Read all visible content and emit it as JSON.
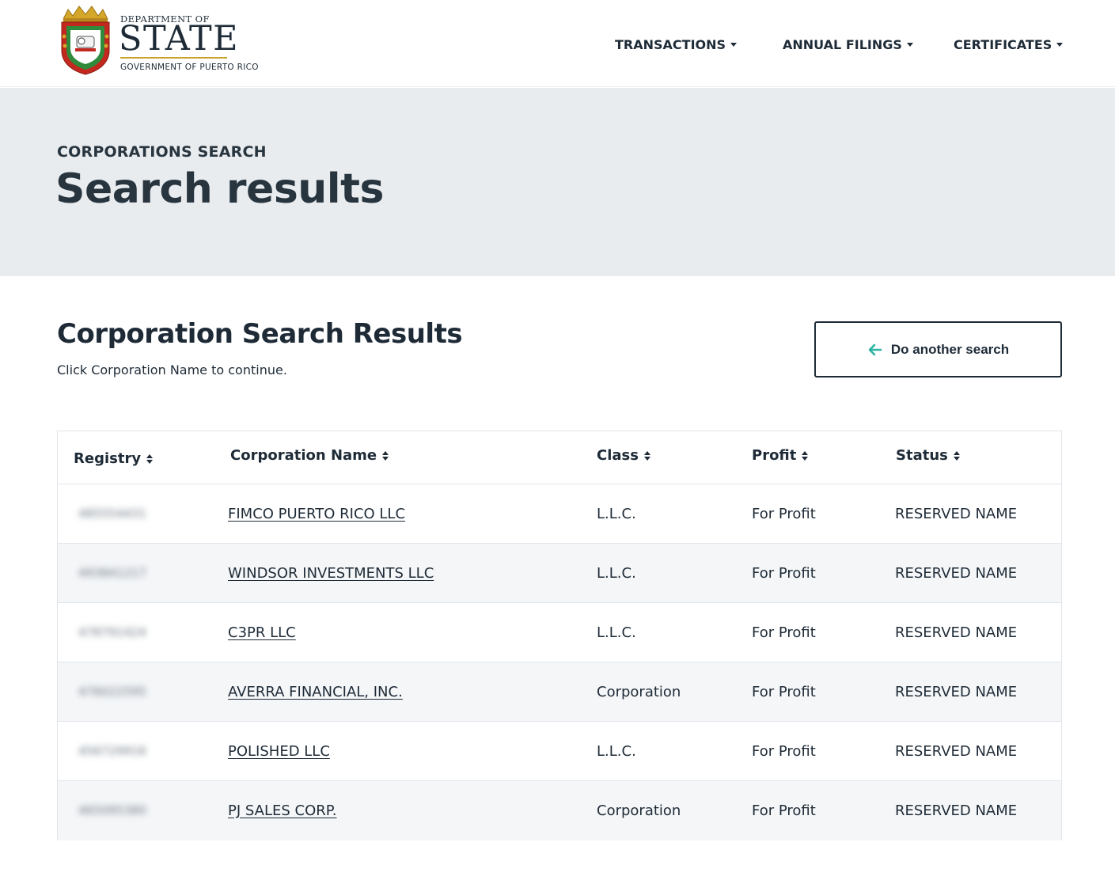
{
  "header": {
    "logo": {
      "dept": "DEPARTMENT OF",
      "state": "STATE",
      "gov": "GOVERNMENT OF PUERTO RICO"
    },
    "nav": [
      {
        "label": "TRANSACTIONS"
      },
      {
        "label": "ANNUAL FILINGS"
      },
      {
        "label": "CERTIFICATES"
      }
    ]
  },
  "hero": {
    "eyebrow": "CORPORATIONS SEARCH",
    "title": "Search results"
  },
  "results": {
    "title": "Corporation Search Results",
    "subtitle": "Click Corporation Name to continue.",
    "again_button": "Do another search",
    "columns": [
      "Registry",
      "Corporation Name",
      "Class",
      "Profit",
      "Status"
    ],
    "rows": [
      {
        "registry": "485554431",
        "name": "FIMCO PUERTO RICO LLC",
        "class": "L.L.C.",
        "profit": "For Profit",
        "status": "RESERVED NAME"
      },
      {
        "registry": "493841217",
        "name": "WINDSOR INVESTMENTS LLC",
        "class": "L.L.C.",
        "profit": "For Profit",
        "status": "RESERVED NAME"
      },
      {
        "registry": "478791424",
        "name": "C3PR LLC",
        "class": "L.L.C.",
        "profit": "For Profit",
        "status": "RESERVED NAME"
      },
      {
        "registry": "476022595",
        "name": "AVERRA FINANCIAL, INC.",
        "class": "Corporation",
        "profit": "For Profit",
        "status": "RESERVED NAME"
      },
      {
        "registry": "456729916",
        "name": "POLISHED LLC",
        "class": "L.L.C.",
        "profit": "For Profit",
        "status": "RESERVED NAME"
      },
      {
        "registry": "465095380",
        "name": "PJ SALES CORP.",
        "class": "Corporation",
        "profit": "For Profit",
        "status": "RESERVED NAME"
      }
    ]
  },
  "colors": {
    "text": "#1e2b37",
    "hero_bg": "#e9ecef",
    "row_alt_bg": "#f4f6f8",
    "accent_arrow": "#2bb3a3",
    "logo_gold": "#c9a227"
  },
  "icons": [
    "seal-icon",
    "caret-down-icon",
    "arrow-left-icon",
    "sort-icon"
  ]
}
